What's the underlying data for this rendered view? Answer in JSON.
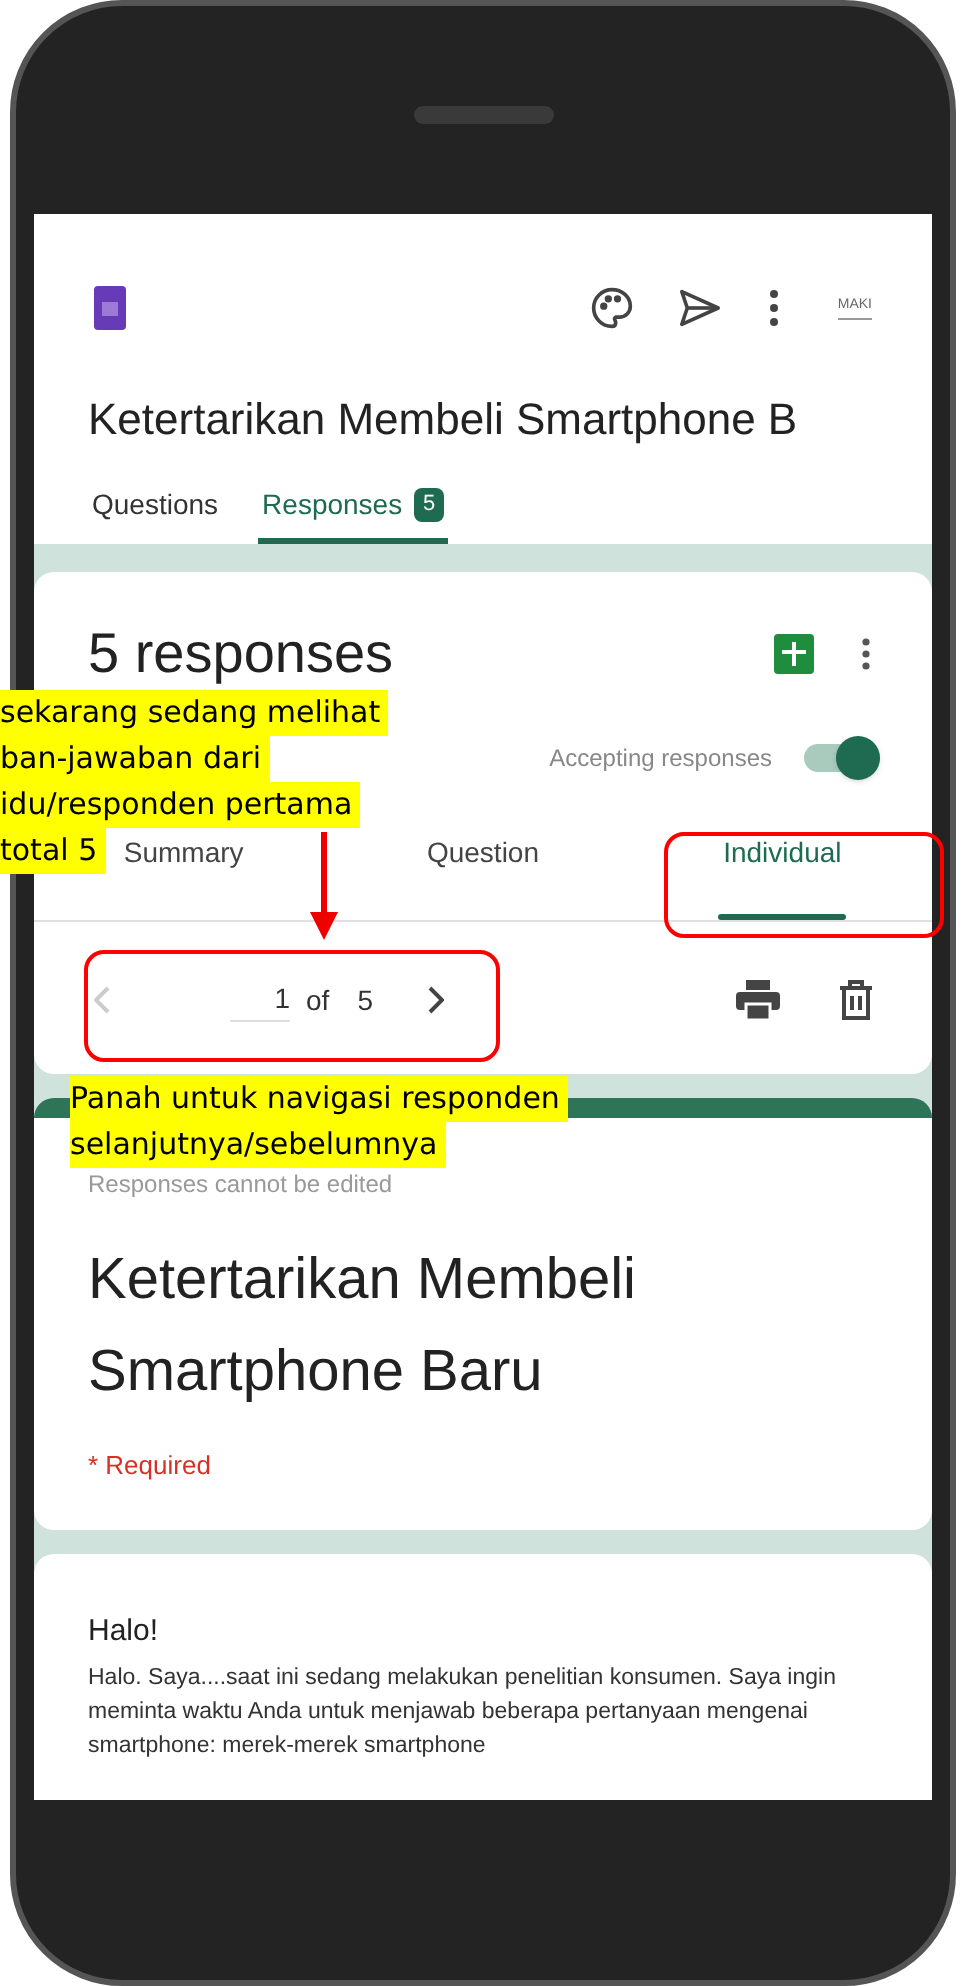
{
  "header": {
    "avatar_text": "MAKI"
  },
  "form_title": "Ketertarikan Membeli Smartphone B",
  "tabs": [
    {
      "label": "Questions",
      "selected": false
    },
    {
      "label": "Responses",
      "selected": true,
      "badge": "5"
    }
  ],
  "responses": {
    "title": "5 responses",
    "accepting": {
      "label": "Accepting responses",
      "on": true
    },
    "view_tabs": [
      {
        "label": "Summary",
        "selected": false
      },
      {
        "label": "Question",
        "selected": false
      },
      {
        "label": "Individual",
        "selected": true
      }
    ],
    "pager": {
      "current": "1",
      "of": "of",
      "total": "5",
      "prev_disabled": true
    }
  },
  "response": {
    "note": "Responses cannot be edited",
    "title": "Ketertarikan Membeli Smartphone Baru",
    "required": "* Required"
  },
  "section": {
    "heading": "Halo!",
    "text": "Halo. Saya....saat ini sedang melakukan penelitian konsumen. Saya ingin meminta waktu Anda untuk menjawab beberapa pertanyaan mengenai smartphone: merek-merek smartphone"
  },
  "annotations": [
    {
      "kind": "callout",
      "lines": [
        "sekarang sedang melihat",
        "ban-jawaban dari",
        "idu/responden pertama",
        "total 5"
      ]
    },
    {
      "kind": "callout",
      "lines": [
        "Panah untuk navigasi responden",
        "selanjutnya/sebelumnya"
      ]
    }
  ]
}
